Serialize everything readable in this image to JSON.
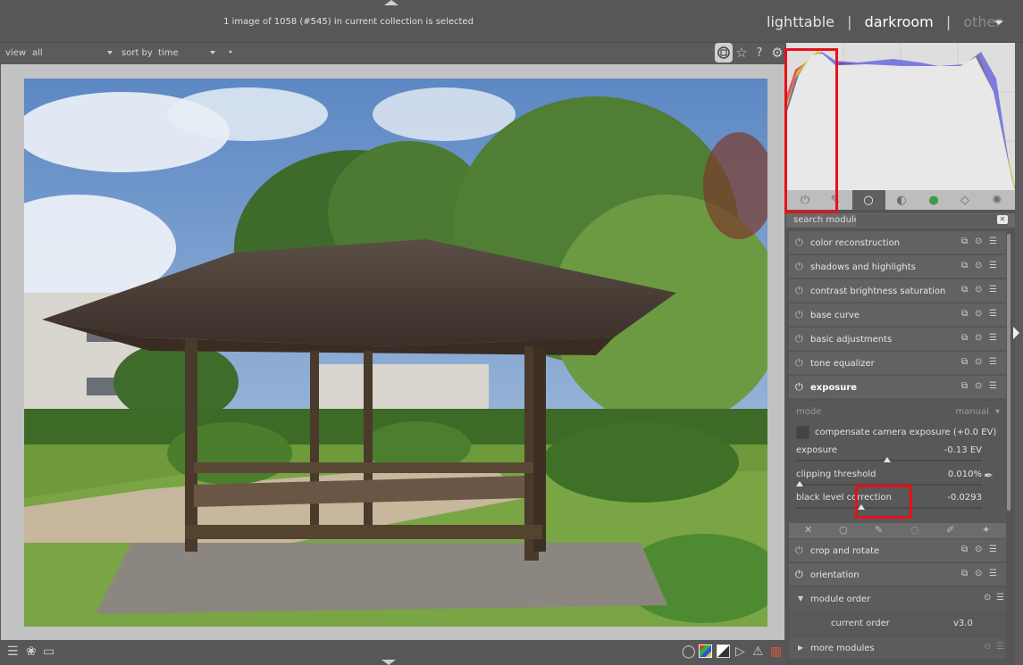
{
  "header": {
    "status": "1 image of 1058 (#545) in current collection is selected",
    "views": {
      "lighttable": "lighttable",
      "sep": "|",
      "darkroom": "darkroom",
      "other": "other"
    }
  },
  "filter": {
    "view_label": "view",
    "view_value": "all",
    "sort_label": "sort by",
    "sort_value": "time",
    "icons": [
      "focus-peaking-icon",
      "star-icon",
      "help-icon",
      "gear-icon"
    ],
    "help_glyph": "?"
  },
  "histogram": {
    "channels": [
      "red",
      "green",
      "blue"
    ]
  },
  "module_groups": [
    "power-icon",
    "pin-icon",
    "base-group-icon",
    "tone-group-icon",
    "color-group-icon",
    "correct-group-icon",
    "effects-group-icon"
  ],
  "search": {
    "label": "search module",
    "placeholder": ""
  },
  "modules": {
    "m0": "color reconstruction",
    "m1": "shadows and highlights",
    "m2": "contrast brightness saturation",
    "m3": "base curve",
    "m4": "basic adjustments",
    "m5": "tone equalizer",
    "m6": "exposure",
    "m7": "crop and rotate",
    "m8": "orientation"
  },
  "exposure": {
    "mode_label": "mode",
    "mode_value": "manual",
    "compensate_label": "compensate camera exposure (+0.0 EV)",
    "exposure_label": "exposure",
    "exposure_value": "-0.13 EV",
    "exposure_level": 0.49,
    "clipping_label": "clipping threshold",
    "clipping_value": "0.010%",
    "clipping_level": 0.02,
    "black_label": "black level correction",
    "black_value": "-0.0293",
    "black_level": 0.35
  },
  "module_order": {
    "title": "module order",
    "current_label": "current order",
    "current_value": "v3.0"
  },
  "more_modules": "more modules",
  "bottom": {
    "icons": [
      "menu-icon",
      "styles-icon",
      "display-icon",
      "bulb-icon",
      "gamut-icon",
      "softproof-icon",
      "color-assessment-icon",
      "warning-icon"
    ]
  }
}
